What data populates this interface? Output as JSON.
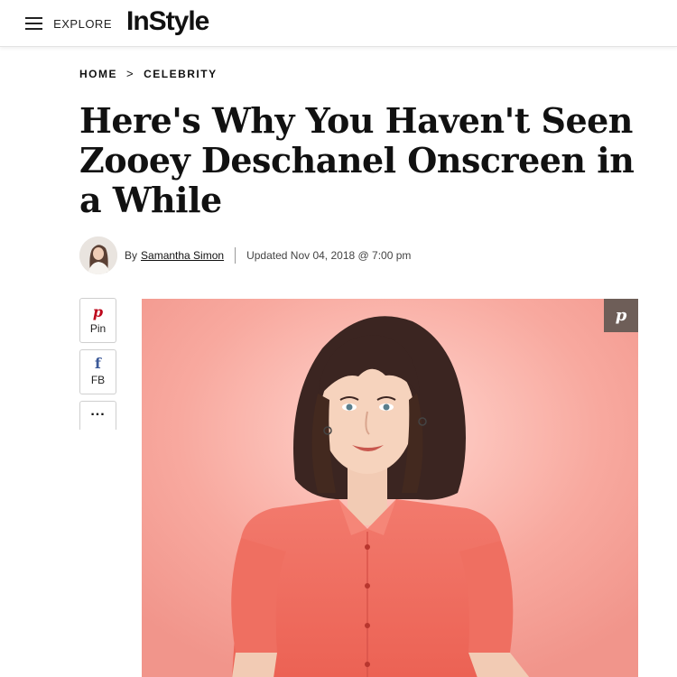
{
  "header": {
    "explore_label": "EXPLORE",
    "logo_text": "InStyle"
  },
  "breadcrumb": {
    "items": [
      "HOME",
      "CELEBRITY"
    ],
    "separator": ">"
  },
  "article": {
    "title": "Here's Why You Haven't Seen Zooey Deschanel Onscreen in a While",
    "byline_prefix": "By",
    "author": "Samantha Simon",
    "updated": "Updated Nov 04, 2018 @ 7:00 pm"
  },
  "share": {
    "pin_label": "Pin",
    "fb_label": "FB",
    "more_label": "..."
  },
  "colors": {
    "hero_background": "#f7a59c",
    "shirt": "#f0675a",
    "hair": "#3a2420",
    "pin_overlay": "#6e5e58",
    "pinterest": "#bd081c",
    "facebook": "#3b5998"
  },
  "icons": {
    "menu": "hamburger-icon",
    "pin": "pinterest-icon",
    "fb": "facebook-icon",
    "more": "more-icon",
    "hero_pin": "pinterest-icon"
  }
}
